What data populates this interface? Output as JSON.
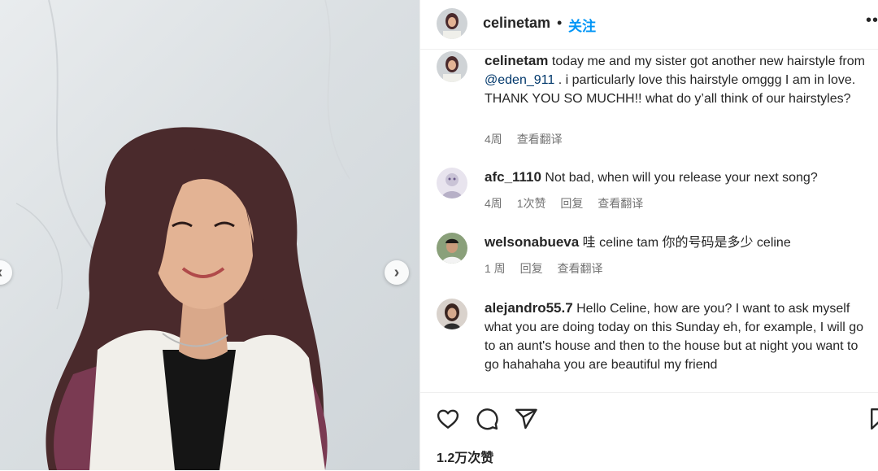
{
  "post": {
    "username": "celinetam",
    "separator": "•",
    "follow_label": "关注",
    "more_label": "•••",
    "likes": "1.2万次赞"
  },
  "caption": {
    "username": "celinetam",
    "text_before": " today me and my sister got another new hairstyle from ",
    "mention": "@eden_911",
    "text_after": " . i particularly love this hairstyle omggg I am in love. THANK YOU SO MUCHH!! what do y’all think of our hairstyles?",
    "time": "4周",
    "translate": "查看翻译"
  },
  "comments": [
    {
      "username": "afc_1110",
      "text": " Not bad, when will you release your next song?",
      "time": "4周",
      "likes": "1次赞",
      "reply": "回复",
      "translate": "查看翻译"
    },
    {
      "username": "welsonabueva",
      "text": " 哇 celine tam 你的号码是多少 celine",
      "time": "1 周",
      "reply": "回复",
      "translate": "查看翻译"
    },
    {
      "username": "alejandro55.7",
      "text": " Hello Celine, how are you? I want to ask myself what you are doing today on this Sunday eh, for example, I will go to an aunt's house and then to the house but at night you want to go hahahaha you are beautiful my friend"
    }
  ],
  "icons": {
    "like": "heart-icon",
    "comment": "comment-icon",
    "share": "share-icon",
    "save": "bookmark-icon",
    "next": "chevron-right-icon",
    "prev": "chevron-left-icon"
  },
  "colors": {
    "link_blue": "#0095f6",
    "mention": "#00376b",
    "meta_gray": "#737373",
    "text": "#262626"
  }
}
